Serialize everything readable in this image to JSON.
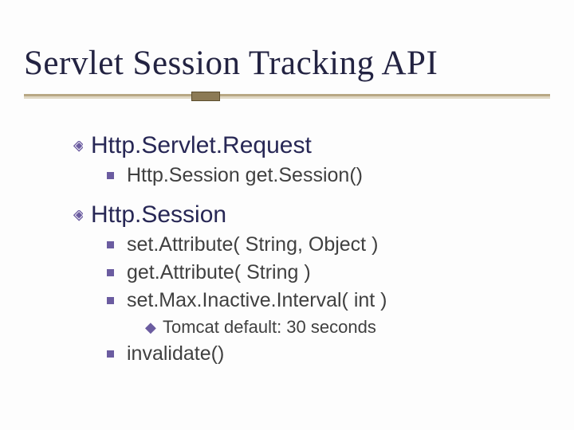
{
  "title": "Servlet Session Tracking API",
  "items": {
    "httpServletRequest": "Http.Servlet.Request",
    "getSession": "Http.Session get.Session()",
    "httpSession": "Http.Session",
    "setAttribute": "set.Attribute( String, Object )",
    "getAttribute": "get.Attribute( String )",
    "setMaxInactive": "set.Max.Inactive.Interval( int )",
    "tomcatDefault": "Tomcat default: 30 seconds",
    "invalidate": "invalidate()"
  }
}
